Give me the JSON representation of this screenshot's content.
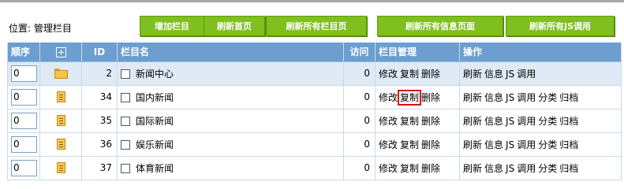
{
  "location": {
    "label": "位置: 管理栏目"
  },
  "toolbar": {
    "add_column": "增加栏目",
    "refresh_home": "刷新首页",
    "refresh_all_columns": "刷新所有栏目页",
    "refresh_all_info": "刷新所有信息页面",
    "refresh_all_js": "刷新所有JS调用"
  },
  "table": {
    "headers": {
      "order": "顺序",
      "id": "ID",
      "name": "栏目名",
      "visits": "访问",
      "manage": "栏目管理",
      "ops": "操作"
    },
    "rows": [
      {
        "order": "0",
        "icon": "folder-icon",
        "id": "2",
        "name": "新闻中心",
        "visits": "0",
        "manage": [
          "修改",
          "复制",
          "删除"
        ],
        "ops": [
          "刷新",
          "信息",
          "JS",
          "调用"
        ],
        "highlight": true
      },
      {
        "order": "0",
        "icon": "document-icon",
        "id": "34",
        "name": "国内新闻",
        "visits": "0",
        "manage": [
          "修改",
          "复制",
          "删除"
        ],
        "ops": [
          "刷新",
          "信息",
          "JS",
          "调用",
          "分类",
          "归档"
        ]
      },
      {
        "order": "0",
        "icon": "document-icon",
        "id": "35",
        "name": "国际新闻",
        "visits": "0",
        "manage": [
          "修改",
          "复制",
          "删除"
        ],
        "ops": [
          "刷新",
          "信息",
          "JS",
          "调用",
          "分类",
          "归档"
        ]
      },
      {
        "order": "0",
        "icon": "document-icon",
        "id": "36",
        "name": "娱乐新闻",
        "visits": "0",
        "manage": [
          "修改",
          "复制",
          "删除"
        ],
        "ops": [
          "刷新",
          "信息",
          "JS",
          "调用",
          "分类",
          "归档"
        ]
      },
      {
        "order": "0",
        "icon": "document-icon",
        "id": "37",
        "name": "体育新闻",
        "visits": "0",
        "manage": [
          "修改",
          "复制",
          "删除"
        ],
        "ops": [
          "刷新",
          "信息",
          "JS",
          "调用",
          "分类",
          "归档"
        ]
      }
    ]
  },
  "colors": {
    "button_green": "#7fbf1e",
    "header_blue": "#6c9ecf",
    "row_highlight": "#dfeaf6",
    "annotation_red": "#e01010"
  }
}
